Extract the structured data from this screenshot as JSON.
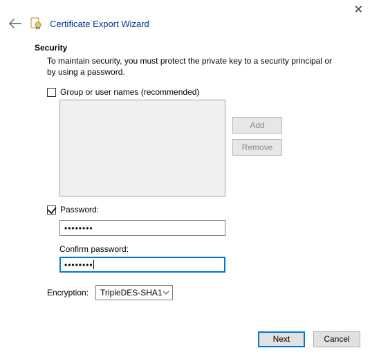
{
  "header": {
    "title": "Certificate Export Wizard"
  },
  "section": {
    "title": "Security",
    "desc": "To maintain security, you must protect the private key to a security principal or by using a password."
  },
  "groupNames": {
    "label": "Group or user names (recommended)",
    "checked": false
  },
  "buttons": {
    "add": "Add",
    "remove": "Remove"
  },
  "password": {
    "checked": true,
    "label": "Password:",
    "value": "••••••••",
    "confirmLabel": "Confirm password:",
    "confirmValue": "••••••••"
  },
  "encryption": {
    "label": "Encryption:",
    "value": "TripleDES-SHA1"
  },
  "footer": {
    "next": "Next",
    "cancel": "Cancel"
  }
}
